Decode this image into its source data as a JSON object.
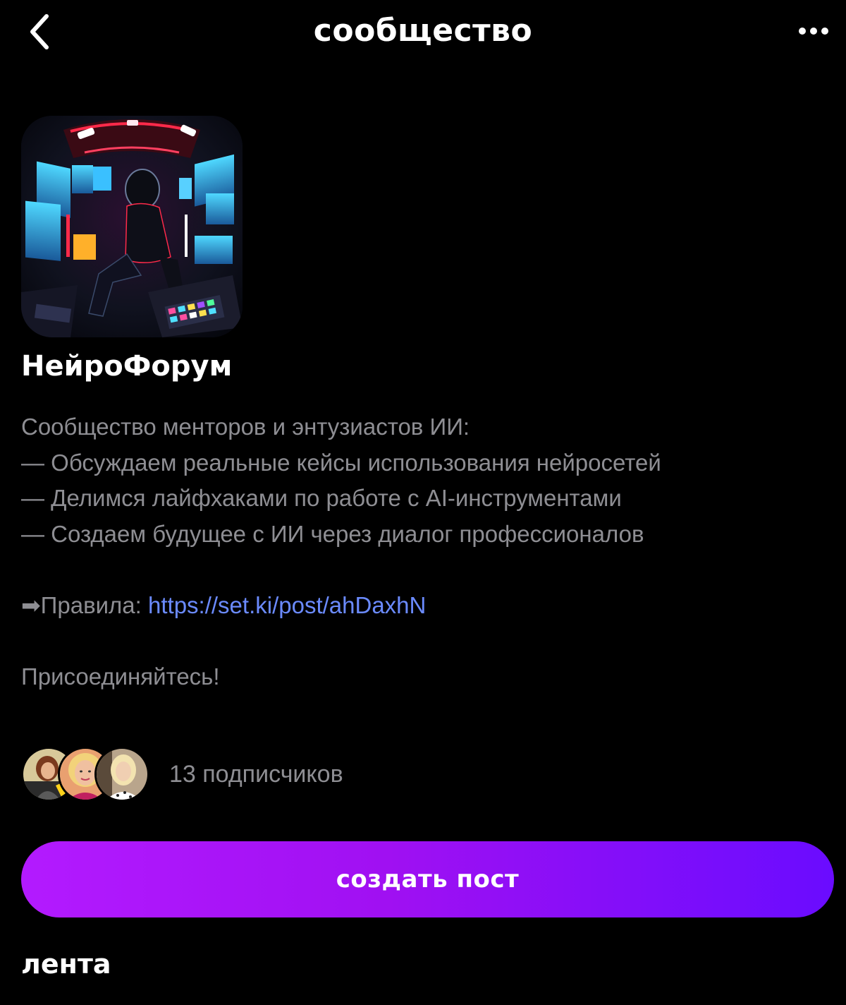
{
  "header": {
    "title": "сообщество",
    "back_icon": "chevron-left-icon",
    "more_icon": "more-horizontal-icon"
  },
  "community": {
    "name": "НейроФорум",
    "avatar_icon": "community-avatar-image",
    "description_lines": [
      "Сообщество менторов и энтузиастов ИИ:",
      "— Обсуждаем реальные кейсы использования нейросетей",
      "— Делимся лайфхаками по работе с AI-инструментами",
      "— Создаем будущее с ИИ через диалог профессионалов"
    ],
    "rules_arrow": "➡",
    "rules_label": "Правила: ",
    "rules_url": "https://set.ki/post/ahDaxhN",
    "join_text": "Присоединяйтесь!"
  },
  "subscribers": {
    "count_text": "13 подписчиков"
  },
  "actions": {
    "create_post_label": "создать пост"
  },
  "feed": {
    "title": "лента"
  },
  "colors": {
    "background": "#000000",
    "text_primary": "#ffffff",
    "text_secondary": "#8e8e93",
    "link": "#6b8bff",
    "button_gradient_start": "#b31aff",
    "button_gradient_end": "#6a0cff"
  }
}
